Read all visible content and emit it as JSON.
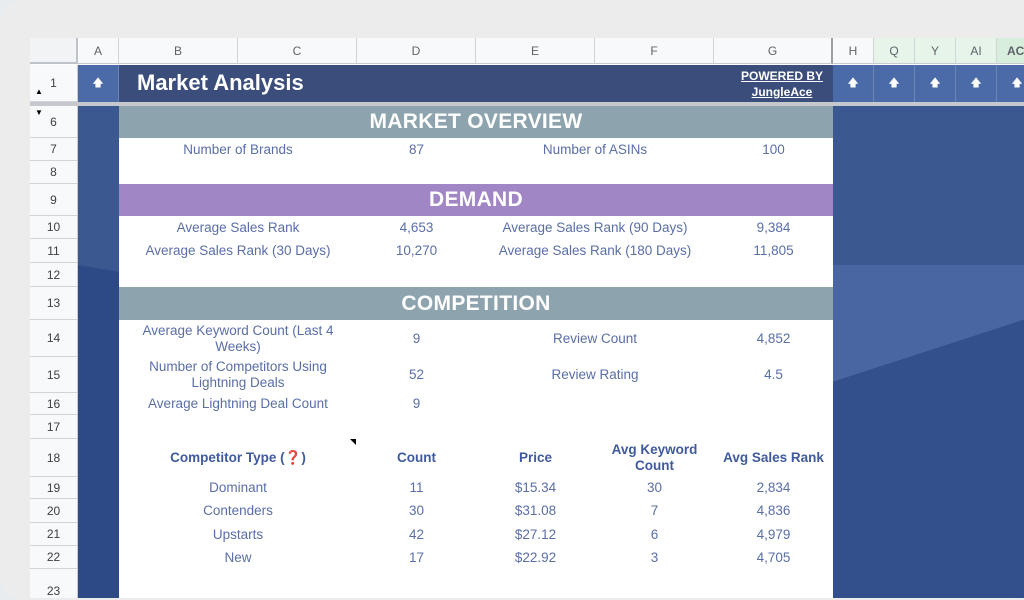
{
  "columns": [
    "A",
    "B",
    "C",
    "D",
    "E",
    "F",
    "G",
    "H",
    "Q",
    "Y",
    "AI",
    "AC"
  ],
  "rows": [
    "1",
    "6",
    "7",
    "8",
    "9",
    "10",
    "11",
    "12",
    "13",
    "14",
    "15",
    "16",
    "17",
    "18",
    "19",
    "20",
    "21",
    "22",
    "23"
  ],
  "arrow_glyph": "🡅",
  "header": {
    "title": "Market Analysis",
    "powered_line1": "POWERED BY",
    "powered_line2": "JungleAce"
  },
  "overview": {
    "band": "MARKET OVERVIEW",
    "brands_label": "Number of Brands",
    "brands_value": "87",
    "asins_label": "Number of ASINs",
    "asins_value": "100"
  },
  "demand": {
    "band": "DEMAND",
    "asr_label": "Average Sales Rank",
    "asr_value": "4,653",
    "asr90_label": "Average Sales Rank (90 Days)",
    "asr90_value": "9,384",
    "asr30_label": "Average Sales Rank (30 Days)",
    "asr30_value": "10,270",
    "asr180_label": "Average Sales Rank (180 Days)",
    "asr180_value": "11,805"
  },
  "competition": {
    "band": "COMPETITION",
    "akc_label": "Average Keyword Count (Last 4 Weeks)",
    "akc_value": "9",
    "review_count_label": "Review Count",
    "review_count_value": "4,852",
    "ld_label": "Number of Competitors Using Lightning Deals",
    "ld_value": "52",
    "review_rating_label": "Review Rating",
    "review_rating_value": "4.5",
    "aldc_label": "Average Lightning Deal Count",
    "aldc_value": "9"
  },
  "table": {
    "headers": {
      "type": "Competitor Type (",
      "type_q": "❓",
      "type_close": ")",
      "count": "Count",
      "price": "Price",
      "akc": "Avg Keyword Count",
      "asr": "Avg Sales Rank"
    },
    "rows": [
      {
        "type": "Dominant",
        "count": "11",
        "price": "$15.34",
        "akc": "30",
        "asr": "2,834"
      },
      {
        "type": "Contenders",
        "count": "30",
        "price": "$31.08",
        "akc": "7",
        "asr": "4,836"
      },
      {
        "type": "Upstarts",
        "count": "42",
        "price": "$27.12",
        "akc": "6",
        "asr": "4,979"
      },
      {
        "type": "New",
        "count": "17",
        "price": "$22.92",
        "akc": "3",
        "asr": "4,705"
      }
    ]
  },
  "colors": {
    "navy": "#3b4d7a",
    "teal_band": "#8da3ad",
    "purple_band": "#a086c4",
    "text": "#5a6ea8"
  }
}
